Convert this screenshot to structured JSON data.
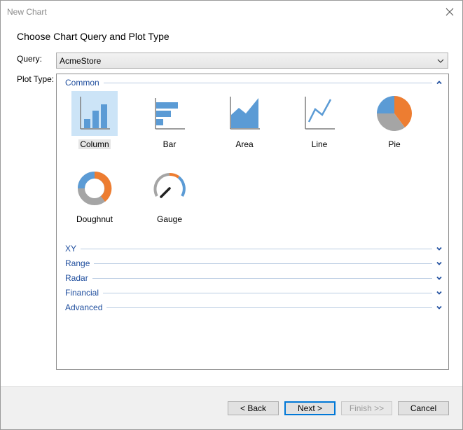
{
  "window": {
    "title": "New Chart"
  },
  "heading": "Choose Chart Query and Plot Type",
  "query": {
    "label": "Query:",
    "value": "AcmeStore"
  },
  "plot_type": {
    "label": "Plot Type:",
    "groups": {
      "common": "Common",
      "xy": "XY",
      "range": "Range",
      "radar": "Radar",
      "financial": "Financial",
      "advanced": "Advanced"
    },
    "common_items": [
      "Column",
      "Bar",
      "Area",
      "Line",
      "Pie",
      "Doughnut",
      "Gauge"
    ],
    "selected": "Column"
  },
  "buttons": {
    "back": "< Back",
    "next": "Next >",
    "finish": "Finish >>",
    "cancel": "Cancel"
  },
  "colors": {
    "accent_blue": "#5b9bd5",
    "accent_orange": "#ed7d31",
    "gray": "#a5a5a5",
    "group_text": "#1f4e9e",
    "selection": "#cce4f7"
  }
}
